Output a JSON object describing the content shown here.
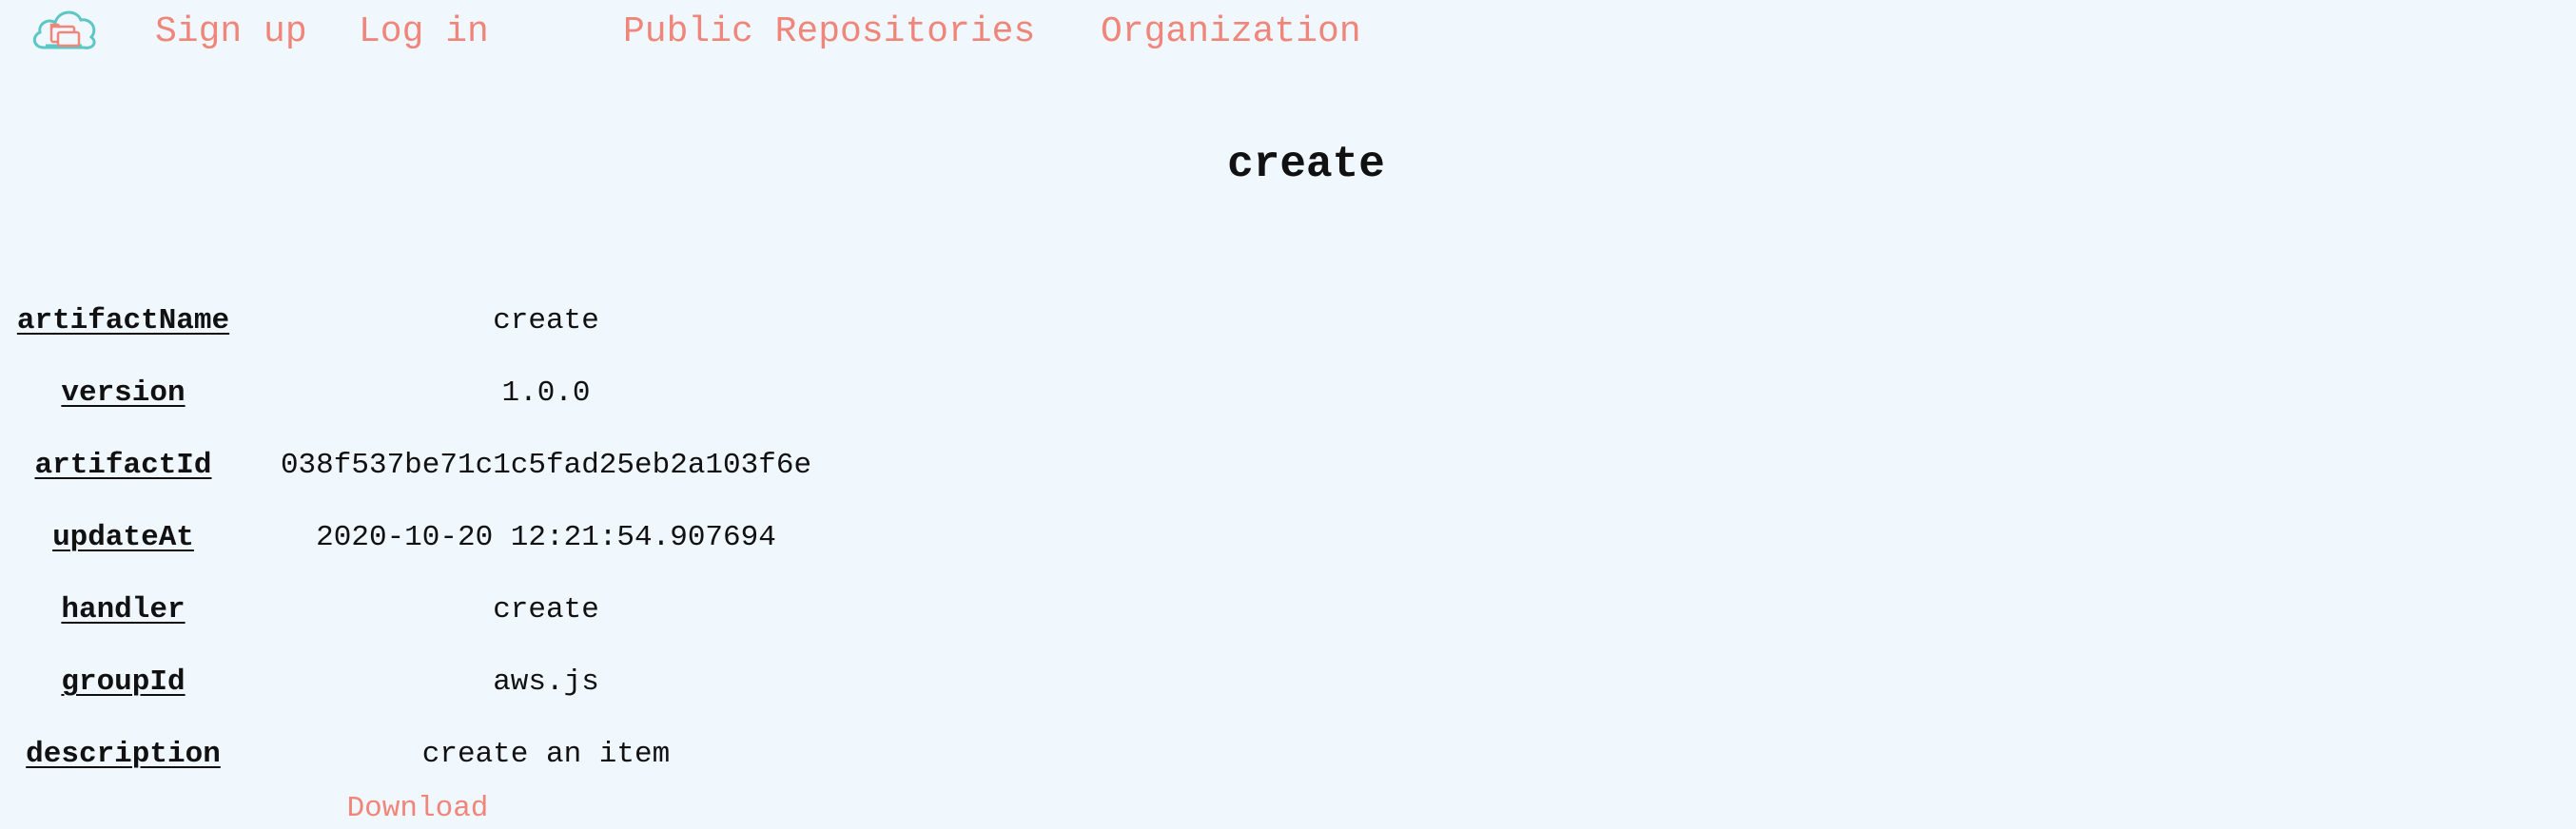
{
  "nav": {
    "logo_icon": "cloud-folder-icon",
    "links": [
      "Sign up",
      "Log in",
      "Public Repositories",
      "Organization"
    ]
  },
  "page_title": "create",
  "details": [
    {
      "key": "artifactName",
      "value": "create"
    },
    {
      "key": "version",
      "value": "1.0.0"
    },
    {
      "key": "artifactId",
      "value": "038f537be71c1c5fad25eb2a103f6e"
    },
    {
      "key": "updateAt",
      "value": "2020-10-20 12:21:54.907694"
    },
    {
      "key": "handler",
      "value": "create"
    },
    {
      "key": "groupId",
      "value": "aws.js"
    },
    {
      "key": "description",
      "value": "create an item"
    }
  ],
  "download_label": "Download",
  "colors": {
    "accent": "#f0857a",
    "logo": "#5cc7c4",
    "background": "#f0f7fd"
  }
}
